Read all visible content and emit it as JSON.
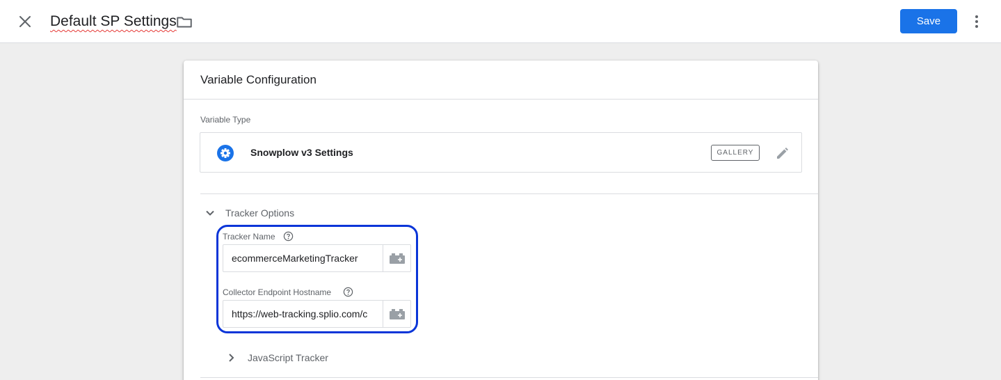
{
  "header": {
    "title": "Default SP Settings",
    "save_label": "Save",
    "close_icon": "close-icon",
    "folder_icon": "folder-icon",
    "more_icon": "more-vert-icon"
  },
  "card": {
    "title": "Variable Configuration",
    "variable_type_label": "Variable Type",
    "variable_type": {
      "name": "Snowplow v3 Settings",
      "icon": "gear-icon",
      "badge": "GALLERY",
      "edit_icon": "pencil-icon"
    }
  },
  "tracker_options": {
    "title": "Tracker Options",
    "expanded": true,
    "fields": [
      {
        "label": "Tracker Name",
        "value": "ecommerceMarketingTracker"
      },
      {
        "label": "Collector Endpoint Hostname",
        "value": "https://web-tracking.splio.com/c"
      }
    ]
  },
  "javascript_tracker": {
    "title": "JavaScript Tracker",
    "expanded": false
  },
  "colors": {
    "accent": "#1a73e8",
    "highlight_border": "#0a35d8",
    "gear_icon_bg": "#1a73e8"
  }
}
